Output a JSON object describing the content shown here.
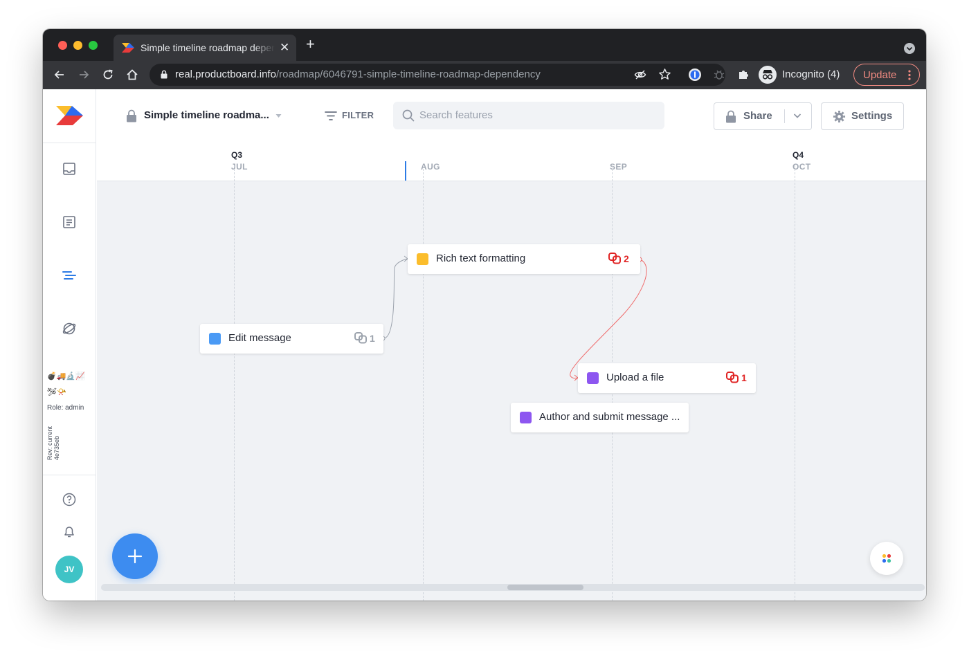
{
  "browser": {
    "tab_title": "Simple timeline roadmap dependency",
    "url_host": "real.productboard.info",
    "url_path": "/roadmap/6046791-simple-timeline-roadmap-dependency",
    "profile_label": "Incognito (4)",
    "update_label": "Update"
  },
  "header": {
    "roadmap_name": "Simple timeline roadma...",
    "filter_label": "FILTER",
    "search_placeholder": "Search features",
    "share_label": "Share",
    "settings_label": "Settings"
  },
  "sidebar": {
    "emoji_line1": "💣🚚🔬📈",
    "emoji_line2": "🛩📯",
    "role": "Role: admin",
    "rev_line1": "Rev: current",
    "rev_line2": "4e735eb",
    "avatar_initials": "JV"
  },
  "timeline": {
    "quarters": [
      "Q3",
      "Q4"
    ],
    "months": [
      "JUL",
      "AUG",
      "SEP",
      "OCT"
    ]
  },
  "features": [
    {
      "title": "Rich text formatting",
      "color": "#fbbd2c",
      "dependency_count": "2",
      "dependency_status": "conflict"
    },
    {
      "title": "Edit message",
      "color": "#4a9af5",
      "dependency_count": "1",
      "dependency_status": "ok"
    },
    {
      "title": "Upload a file",
      "color": "#8d56f0",
      "dependency_count": "1",
      "dependency_status": "conflict"
    },
    {
      "title": "Author and submit message ...",
      "color": "#8d56f0"
    }
  ],
  "colors": {
    "accent": "#2c7be5",
    "conflict": "#e02424",
    "fab": "#3d8cf0"
  },
  "icons": {
    "fab": "plus-icon",
    "apps": "apps-grid-icon"
  }
}
